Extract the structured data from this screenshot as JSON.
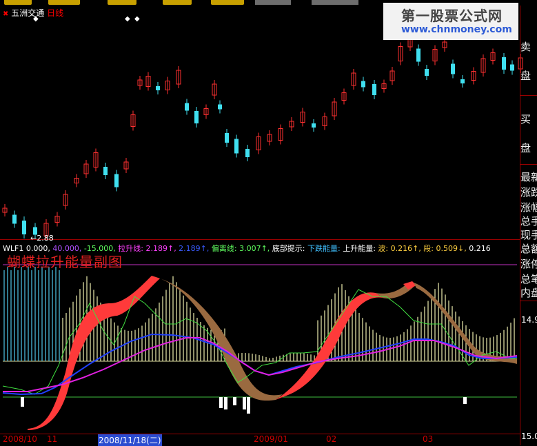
{
  "stock": {
    "name": "五洲交通",
    "period": "日线"
  },
  "watermark": {
    "line1": "第一股票公式网",
    "line2": "www.chnmoney.com"
  },
  "side_panel": {
    "labels": [
      "卖",
      "盘",
      "买",
      "盘",
      "最新",
      "涨跌",
      "涨幅",
      "总手",
      "现手",
      "总额",
      "涨停",
      "总笔",
      "内盘"
    ]
  },
  "indicator": {
    "name": "WLF1",
    "values": [
      {
        "text": "0.000,",
        "color": "#ffffff"
      },
      {
        "text": "40.000,",
        "color": "#b050ff"
      },
      {
        "text": "-15.000,",
        "color": "#60ff60"
      },
      {
        "text": "拉升线: 2.189↑,",
        "color": "#ff40ff"
      },
      {
        "text": "2.189↑,",
        "color": "#3a5bff"
      },
      {
        "text": "偏离线: 3.007↑,",
        "color": "#60ff60"
      },
      {
        "text": "底部提示:",
        "color": "#ffffff"
      },
      {
        "text": "下跌能量:",
        "color": "#40c0ff"
      },
      {
        "text": "上升能量:",
        "color": "#ffffff"
      },
      {
        "text": "波: 0.216↑,",
        "color": "#ffd040"
      },
      {
        "text": "段: 0.509↓,",
        "color": "#ffd040"
      },
      {
        "text": "0.216",
        "color": "#ffffff"
      }
    ],
    "title": "蝴蝶拉升能量副图"
  },
  "price_marker": "←2.88",
  "right_values": {
    "v1": "14.9",
    "v2": "15.0"
  },
  "dates": [
    {
      "text": "2008/10",
      "hl": false
    },
    {
      "text": "11",
      "hl": false
    },
    {
      "text": "2008/11/18(二)",
      "hl": true
    },
    {
      "text": "2009/01",
      "hl": false
    },
    {
      "text": "02",
      "hl": false
    },
    {
      "text": "03",
      "hl": false
    }
  ],
  "colors": {
    "up": "#ff3030",
    "down": "#40e0f0",
    "accent": "#900000",
    "magenta": "#e020e0",
    "blue": "#2040ff"
  }
}
